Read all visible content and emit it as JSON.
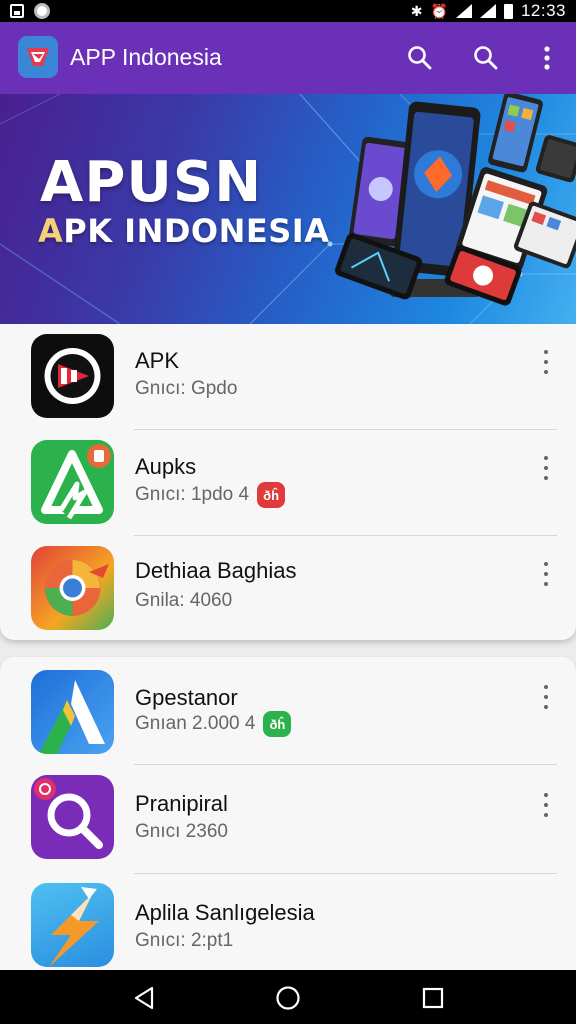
{
  "status_bar": {
    "time": "12:33",
    "left_icons": [
      "image-icon",
      "circle-icon"
    ],
    "right_icons": [
      "bluetooth-icon",
      "alarm-icon",
      "wifi-icon",
      "signal-icon",
      "battery-icon"
    ]
  },
  "app_bar": {
    "title": "APP Indonesia",
    "icons": [
      "search-icon",
      "search-icon",
      "more-vert-icon"
    ],
    "color": "#6a30b8"
  },
  "banner": {
    "title": "APUSN",
    "subtitle_first": "A",
    "subtitle_rest": "PK INDONESIA"
  },
  "list_1": [
    {
      "title": "APK",
      "subtitle": "Gnıcı: Gpdo",
      "icon": "apk-red-icon",
      "badge": ""
    },
    {
      "title": "Aupks",
      "subtitle": "Gnıcı: 1pdo 4",
      "icon": "green-a-icon",
      "badge": "red",
      "badge_text": "ðĥ"
    },
    {
      "title": "Dethiaa Baghias",
      "subtitle": "Gnila: 4060",
      "icon": "chrome-like-icon",
      "badge": ""
    }
  ],
  "list_2": [
    {
      "title": "Gpestanor",
      "subtitle": "Gnıan 2.000 4",
      "icon": "blue-a-icon",
      "badge": "green",
      "badge_text": "ðĥ"
    },
    {
      "title": "Pranipiral",
      "subtitle": "Gnıcı 2360",
      "icon": "magnifier-icon",
      "badge": ""
    },
    {
      "title": "Aplila Sanlıgelesia",
      "subtitle": "Gnıcı: 2:pt1",
      "icon": "lightning-icon",
      "badge": ""
    }
  ],
  "nav_bar": {
    "icons": [
      "back-icon",
      "home-icon",
      "recents-icon"
    ]
  },
  "colors": {
    "accent": "#6a30b8",
    "badge_red": "#e03a3a",
    "badge_green": "#2bb24c"
  }
}
